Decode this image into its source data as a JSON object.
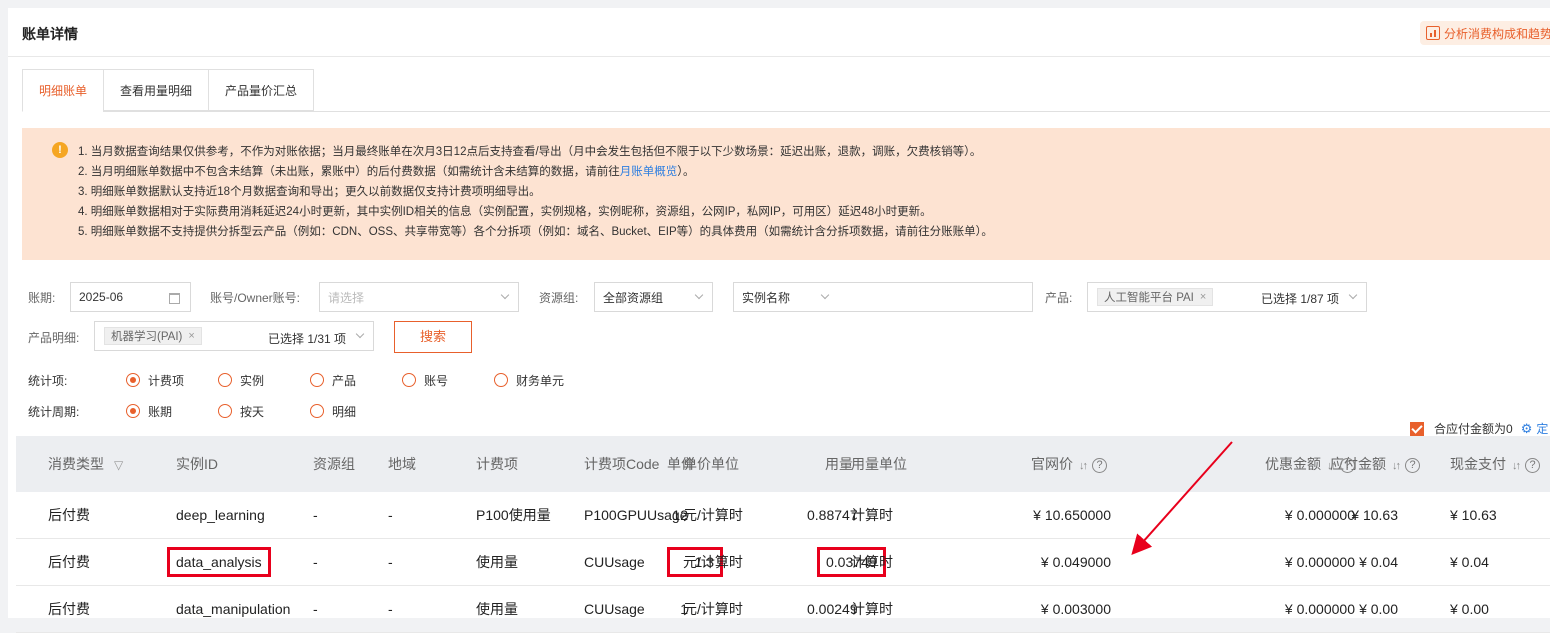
{
  "header": {
    "title": "账单详情",
    "analyze_label": "分析消费构成和趋势"
  },
  "tabs": [
    "明细账单",
    "查看用量明细",
    "产品量价汇总"
  ],
  "notice": {
    "lines": [
      "1. 当月数据查询结果仅供参考，不作为对账依据；当月最终账单在次月3日12点后支持查看/导出（月中会发生包括但不限于以下少数场景：延迟出账，退款，调账，欠费核销等）。",
      "2. 当月明细账单数据中不包含未结算（未出账，累账中）的后付费数据（如需统计含未结算的数据，请前往",
      "3. 明细账单数据默认支持近18个月数据查询和导出；更久以前数据仅支持计费项明细导出。",
      "4. 明细账单数据相对于实际费用消耗延迟24小时更新，其中实例ID相关的信息（实例配置，实例规格，实例昵称，资源组，公网IP，私网IP，可用区）延迟48小时更新。",
      "5. 明细账单数据不支持提供分拆型云产品（例如：CDN、OSS、共享带宽等）各个分拆项（例如：域名、Bucket、EIP等）的具体费用（如需统计含分拆项数据，请前往分账账单）。"
    ],
    "line2_link": "月账单概览",
    "line2_suffix": "）。"
  },
  "filters": {
    "period_label": "账期:",
    "period_value": "2025-06",
    "account_label": "账号/Owner账号:",
    "account_placeholder": "请选择",
    "rg_label": "资源组:",
    "rg_value": "全部资源组",
    "instance_name_value": "实例名称",
    "product_label": "产品:",
    "product_chip": "人工智能平台 PAI",
    "product_selected": "已选择 1/87 项",
    "product_detail_label": "产品明细:",
    "product_detail_chip": "机器学习(PAI)",
    "product_detail_selected": "已选择 1/31 项",
    "search_label": "搜索"
  },
  "stat_item": {
    "label": "统计项:",
    "options": [
      "计费项",
      "实例",
      "产品",
      "账号",
      "财务单元"
    ],
    "selected": 0
  },
  "stat_period": {
    "label": "统计周期:",
    "options": [
      "账期",
      "按天",
      "明细"
    ],
    "selected": 0
  },
  "toggle": {
    "label": "合应付金额为0",
    "config_label": "定"
  },
  "table": {
    "columns": [
      "消费类型",
      "实例ID",
      "资源组",
      "地域",
      "计费项",
      "计费项Code",
      "单价",
      "单价单位",
      "用量",
      "用量单位",
      "官网价",
      "优惠金额",
      "应付金额",
      "现金支付"
    ],
    "rows": [
      [
        "后付费",
        "deep_learning",
        "-",
        "-",
        "P100使用量",
        "P100GPUUsage",
        "12",
        "元/计算时",
        "0.88747",
        "计算时",
        "¥ 10.650000",
        "¥ 0.000000",
        "¥ 10.63",
        "¥ 10.63"
      ],
      [
        "后付费",
        "data_analysis",
        "-",
        "-",
        "使用量",
        "CUUsage",
        "1.3",
        "元/计算时",
        "0.03749",
        "计算时",
        "¥ 0.049000",
        "¥ 0.000000",
        "¥ 0.04",
        "¥ 0.04"
      ],
      [
        "后付费",
        "data_manipulation",
        "-",
        "-",
        "使用量",
        "CUUsage",
        "1",
        "元/计算时",
        "0.00249",
        "计算时",
        "¥ 0.003000",
        "¥ 0.000000",
        "¥ 0.00",
        "¥ 0.00"
      ]
    ]
  },
  "colors": {
    "accent": "#e8602c",
    "notice_bg": "#fde3d2",
    "money_green": "#2ca02c",
    "highlight_red": "#e8001c"
  }
}
